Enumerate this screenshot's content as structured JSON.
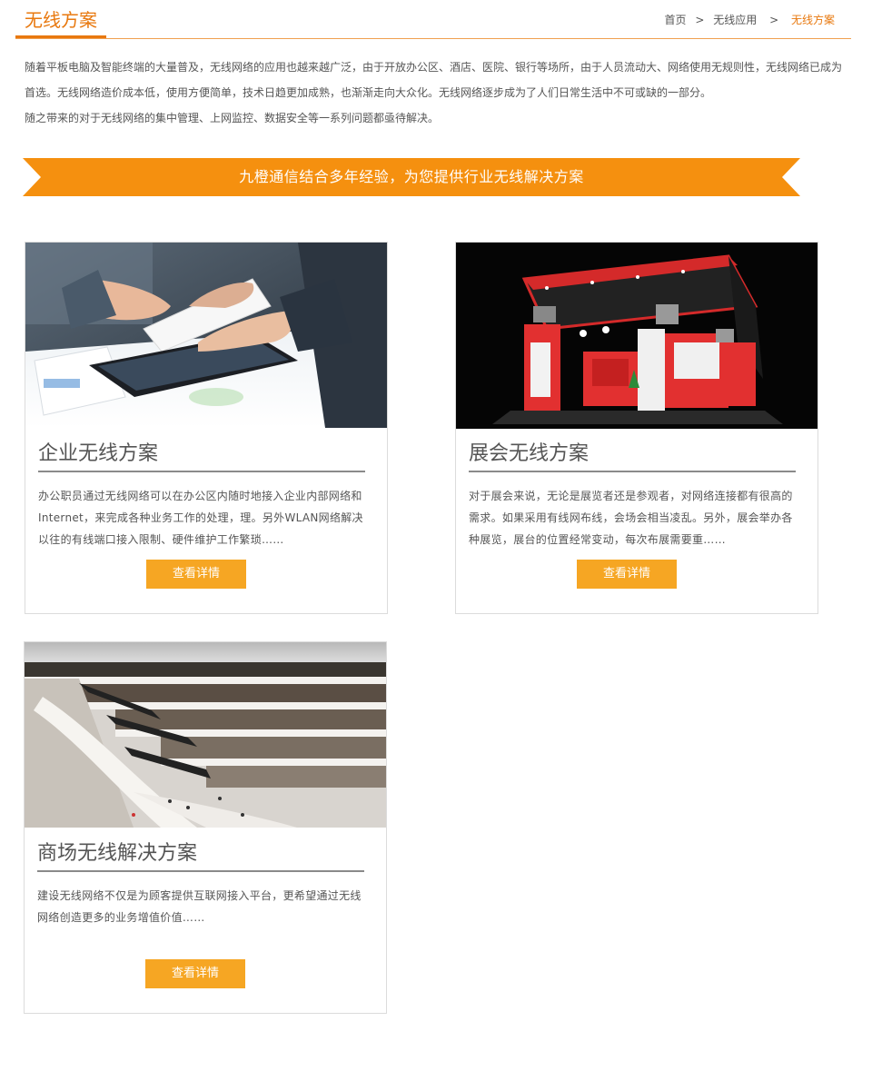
{
  "header": {
    "title": "无线方案",
    "breadcrumb": {
      "home": "首页",
      "sep1": ">",
      "parent": "无线应用",
      "sep2": ">",
      "current": "无线方案"
    }
  },
  "intro": {
    "line1": "随着平板电脑及智能终端的大量普及，无线网络的应用也越来越广泛，由于开放办公区、酒店、医院、银行等场所，由于人员流动大、网络使用无规则性，无线网络已成为",
    "line2": "首选。无线网络造价成本低，使用方便简单，技术日趋更加成熟，也渐渐走向大众化。无线网络逐步成为了人们日常生活中不可或缺的一部分。",
    "line3": "随之带来的对于无线网络的集中管理、上网监控、数据安全等一系列问题都亟待解决。"
  },
  "banner": {
    "text": "九橙通信结合多年经验，为您提供行业无线解决方案",
    "color": "#f5900f"
  },
  "colors": {
    "accent": "#e8780e",
    "button": "#f6a623"
  },
  "cards": [
    {
      "title": "企业无线方案",
      "description": "办公职员通过无线网络可以在办公区内随时地接入企业内部网络和Internet，来完成各种业务工作的处理，理。另外WLAN网络解决以往的有线端口接入限制、硬件维护工作繁琐……",
      "button": "查看详情"
    },
    {
      "title": "展会无线方案",
      "description": "对于展会来说，无论是展览者还是参观者，对网络连接都有很高的需求。如果采用有线网布线，会场会相当凌乱。另外，展会举办各种展览，展台的位置经常变动，每次布展需要重……",
      "button": "查看详情"
    },
    {
      "title": "商场无线解决方案",
      "description": "建设无线网络不仅是为顾客提供互联网接入平台，更希望通过无线网络创造更多的业务增值价值……",
      "button": "查看详情"
    }
  ]
}
